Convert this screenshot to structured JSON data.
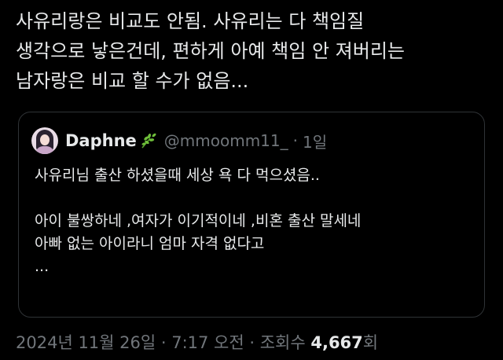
{
  "tweet": {
    "lines": [
      "사유리랑은 비교도 안됨. 사유리는 다 책임질",
      "생각으로 낳은건데, 편하게 아예 책임 안 져버리는",
      "남자랑은 비교 할 수가 없음..."
    ]
  },
  "quote": {
    "display_name": "Daphne",
    "badge_icon": "leaf-emoji-icon",
    "handle": "@mmoomm11_",
    "separator": "·",
    "time": "1일",
    "body_lines": [
      "사유리님 출산 하셨을때 세상 욕 다 먹으셨음..",
      "",
      "아이 불쌍하네 ,여자가 이기적이네 ,비혼 출산 말세네",
      "아빠 없는 아이라니 엄마 자격 없다고",
      "..."
    ]
  },
  "meta": {
    "timestamp": "2024년 11월 26일 · 7:17 오전 · 조회수 ",
    "views_count": "4,667",
    "views_suffix": "회"
  },
  "colors": {
    "background": "#000000",
    "text": "#e7e9ea",
    "muted": "#71767b",
    "border": "#2f3336",
    "leaf": "#6fbf3a"
  }
}
